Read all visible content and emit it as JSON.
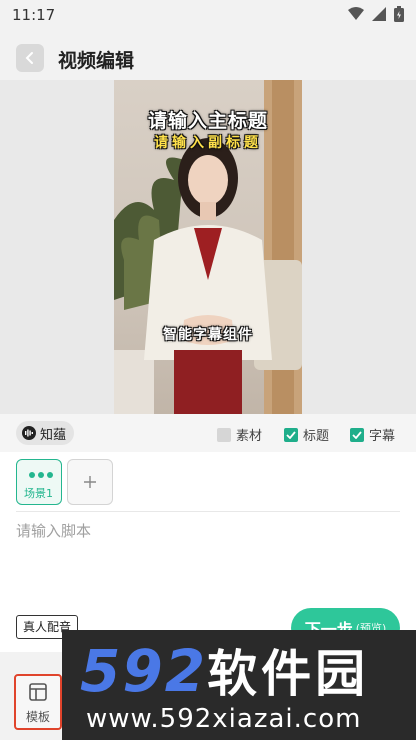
{
  "status_bar": {
    "time": "11:17",
    "icons": [
      "wifi-icon",
      "signal-icon",
      "battery-icon"
    ]
  },
  "header": {
    "title": "视频编辑",
    "back_icon": "chevron-left-icon"
  },
  "preview": {
    "main_title": "请输入主标题",
    "sub_title": "请输入副标题",
    "caption": "智能字幕组件"
  },
  "toolbar": {
    "brand": "知蕴",
    "options": [
      {
        "label": "素材",
        "checked": false
      },
      {
        "label": "标题",
        "checked": true
      },
      {
        "label": "字幕",
        "checked": true
      }
    ]
  },
  "scenes": {
    "items": [
      {
        "label": "场景1"
      }
    ],
    "add_icon": "plus-icon"
  },
  "script": {
    "placeholder": "请输入脚本",
    "value": ""
  },
  "actions": {
    "voice_label": "真人配音",
    "next_label": "下一步",
    "next_sub": "(预览)"
  },
  "bottom_nav": {
    "template_label": "模板",
    "template_icon": "layout-icon"
  },
  "watermark": {
    "brand_digits": "592",
    "brand_text": "软件园",
    "url": "www.592xiazai.com"
  },
  "colors": {
    "accent": "#2ec79a",
    "checkbox_on": "#1fae8b",
    "tab_highlight": "#e0442c",
    "watermark_blue": "#4a78e6"
  }
}
